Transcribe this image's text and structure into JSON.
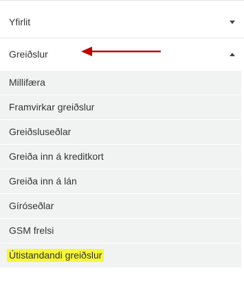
{
  "menu": {
    "items": [
      {
        "label": "Yfirlit",
        "expanded": false
      },
      {
        "label": "Greiðslur",
        "expanded": true
      }
    ],
    "subitems": [
      {
        "label": "Millifæra"
      },
      {
        "label": "Framvirkar greiðslur"
      },
      {
        "label": "Greiðsluseðlar"
      },
      {
        "label": "Greiða inn á kreditkort"
      },
      {
        "label": "Greiða inn á lán"
      },
      {
        "label": "Gíróseðlar"
      },
      {
        "label": "GSM frelsi"
      },
      {
        "label": "Útistandandi greiðslur",
        "highlighted": true,
        "highlight_color": "#f7f73a"
      }
    ]
  },
  "annotation": {
    "arrow_color": "#c00000"
  }
}
